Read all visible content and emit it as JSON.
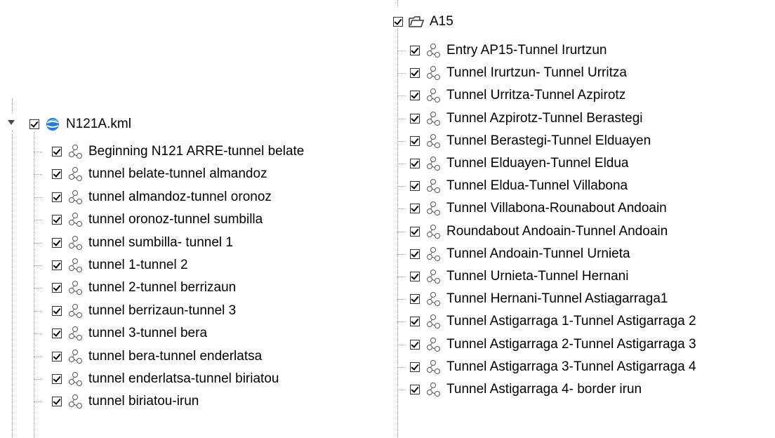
{
  "left_tree": {
    "root": {
      "label": "N121A.kml",
      "checked": true,
      "expanded": true,
      "icon": "earth-icon"
    },
    "items": [
      {
        "label": "Beginning N121 ARRE-tunnel belate",
        "checked": true,
        "icon": "path-icon"
      },
      {
        "label": "tunnel belate-tunnel almandoz",
        "checked": true,
        "icon": "path-icon"
      },
      {
        "label": "tunnel almandoz-tunnel oronoz",
        "checked": true,
        "icon": "path-icon"
      },
      {
        "label": "tunnel oronoz-tunnel sumbilla",
        "checked": true,
        "icon": "path-icon"
      },
      {
        "label": "tunnel sumbilla- tunnel 1",
        "checked": true,
        "icon": "path-icon"
      },
      {
        "label": "tunnel 1-tunnel 2",
        "checked": true,
        "icon": "path-icon"
      },
      {
        "label": "tunnel 2-tunnel berrizaun",
        "checked": true,
        "icon": "path-icon"
      },
      {
        "label": "tunnel berrizaun-tunnel 3",
        "checked": true,
        "icon": "path-icon"
      },
      {
        "label": "tunnel 3-tunnel bera",
        "checked": true,
        "icon": "path-icon"
      },
      {
        "label": "tunnel bera-tunnel enderlatsa",
        "checked": true,
        "icon": "path-icon"
      },
      {
        "label": "tunnel enderlatsa-tunnel biriatou",
        "checked": true,
        "icon": "path-icon"
      },
      {
        "label": "tunnel biriatou-irun",
        "checked": true,
        "icon": "path-icon"
      }
    ]
  },
  "right_tree": {
    "root": {
      "label": "A15",
      "checked": true,
      "icon": "open-folder-icon"
    },
    "items": [
      {
        "label": "Entry AP15-Tunnel Irurtzun",
        "checked": true,
        "icon": "path-icon"
      },
      {
        "label": "Tunnel Irurtzun- Tunnel Urritza",
        "checked": true,
        "icon": "path-icon"
      },
      {
        "label": "Tunnel Urritza-Tunnel Azpirotz",
        "checked": true,
        "icon": "path-icon"
      },
      {
        "label": "Tunnel Azpirotz-Tunnel Berastegi",
        "checked": true,
        "icon": "path-icon"
      },
      {
        "label": "Tunnel Berastegi-Tunnel Elduayen",
        "checked": true,
        "icon": "path-icon"
      },
      {
        "label": "Tunnel Elduayen-Tunnel Eldua",
        "checked": true,
        "icon": "path-icon"
      },
      {
        "label": "Tunnel Eldua-Tunnel Villabona",
        "checked": true,
        "icon": "path-icon"
      },
      {
        "label": "Tunnel Villabona-Rounabout Andoain",
        "checked": true,
        "icon": "path-icon"
      },
      {
        "label": "Roundabout Andoain-Tunnel Andoain",
        "checked": true,
        "icon": "path-icon"
      },
      {
        "label": "Tunnel Andoain-Tunnel Urnieta",
        "checked": true,
        "icon": "path-icon"
      },
      {
        "label": "Tunnel Urnieta-Tunnel Hernani",
        "checked": true,
        "icon": "path-icon"
      },
      {
        "label": "Tunnel Hernani-Tunnel Astiagarraga1",
        "checked": true,
        "icon": "path-icon"
      },
      {
        "label": "Tunnel Astigarraga 1-Tunnel Astigarraga 2",
        "checked": true,
        "icon": "path-icon"
      },
      {
        "label": "Tunnel Astigarraga 2-Tunnel Astigarraga 3",
        "checked": true,
        "icon": "path-icon"
      },
      {
        "label": "Tunnel Astigarraga 3-Tunnel Astigarraga 4",
        "checked": true,
        "icon": "path-icon"
      },
      {
        "label": "Tunnel Astigarraga 4- border irun",
        "checked": true,
        "icon": "path-icon"
      }
    ]
  }
}
